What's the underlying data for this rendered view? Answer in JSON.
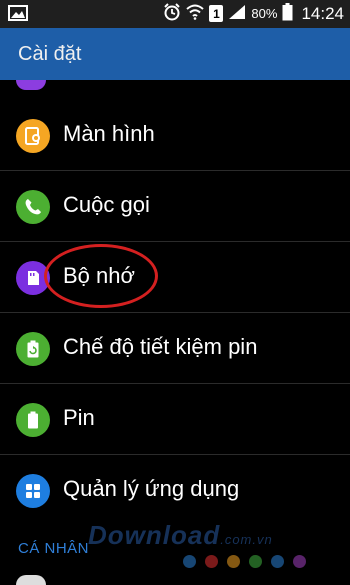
{
  "statusbar": {
    "battery_percent": "80%",
    "time": "14:24",
    "sim_slot": "1"
  },
  "appbar": {
    "title": "Cài đặt"
  },
  "settings": [
    {
      "label": "Màn hình",
      "icon": "display-icon",
      "color": "#f5a623"
    },
    {
      "label": "Cuộc gọi",
      "icon": "phone-icon",
      "color": "#4caf32"
    },
    {
      "label": "Bộ nhớ",
      "icon": "storage-icon",
      "color": "#7b2fe0"
    },
    {
      "label": "Chế độ tiết kiệm pin",
      "icon": "power-saving-icon",
      "color": "#4caf32"
    },
    {
      "label": "Pin",
      "icon": "battery-icon",
      "color": "#4caf32"
    },
    {
      "label": "Quản lý ứng dụng",
      "icon": "apps-icon",
      "color": "#1e7ee0"
    }
  ],
  "section_header": "CÁ NHÂN",
  "watermark": {
    "brand": "Download",
    "suffix": ".com.vn"
  },
  "watermark_dot_colors": [
    "#2a7fd4",
    "#e03030",
    "#f0a020",
    "#40b040",
    "#2a7fd4",
    "#a040c0"
  ]
}
